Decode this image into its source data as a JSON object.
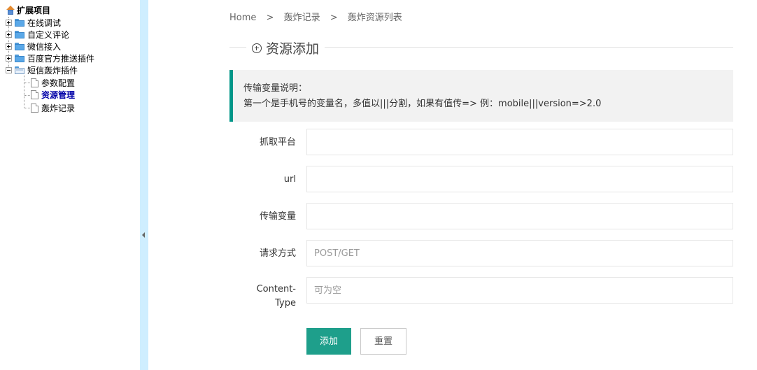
{
  "tree": {
    "root": "扩展项目",
    "nodes": [
      {
        "label": "在线调试",
        "icon": "folder-icon"
      },
      {
        "label": "自定义评论",
        "icon": "folder-icon"
      },
      {
        "label": "微信接入",
        "icon": "folder-icon"
      },
      {
        "label": "百度官方推送插件",
        "icon": "folder-icon"
      },
      {
        "label": "短信轰炸插件",
        "icon": "folder-open-icon"
      }
    ],
    "children": [
      {
        "label": "参数配置",
        "icon": "document-icon"
      },
      {
        "label": "资源管理",
        "icon": "document-icon",
        "active": true
      },
      {
        "label": "轰炸记录",
        "icon": "document-icon"
      }
    ]
  },
  "breadcrumb": {
    "items": [
      "Home",
      "轰炸记录",
      "轰炸资源列表"
    ],
    "separator": ">"
  },
  "legend": {
    "title": "资源添加",
    "icon": "plus-circle-icon"
  },
  "note": {
    "line1": "传输变量说明：",
    "line2": "第一个是手机号的变量名，多值以|||分割，如果有值传=> 例：mobile|||version=>2.0"
  },
  "form": {
    "fields": [
      {
        "label": "抓取平台",
        "value": "",
        "placeholder": ""
      },
      {
        "label": "url",
        "value": "",
        "placeholder": ""
      },
      {
        "label": "传输变量",
        "value": "",
        "placeholder": ""
      },
      {
        "label": "请求方式",
        "value": "",
        "placeholder": "POST/GET"
      },
      {
        "label_line1": "Content-",
        "label_line2": "Type",
        "value": "",
        "placeholder": "可为空"
      }
    ],
    "submit_label": "添加",
    "reset_label": "重置"
  },
  "colors": {
    "accent": "#009688",
    "button": "#1e9f8b",
    "splitter": "#cfeeff",
    "active_tree_item": "#0000a8"
  }
}
